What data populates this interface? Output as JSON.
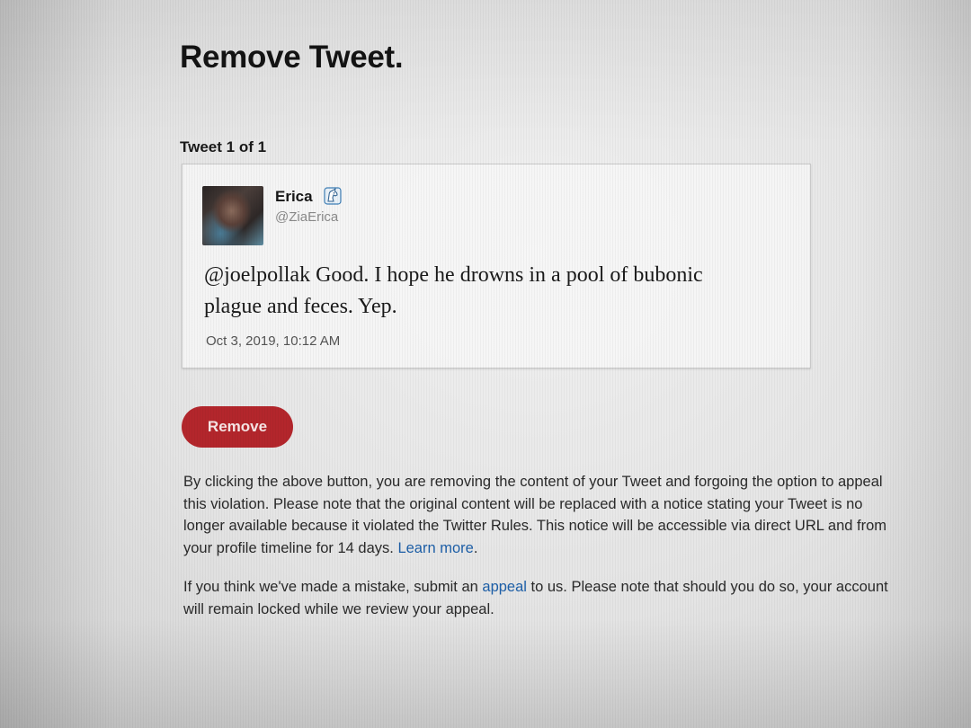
{
  "page": {
    "title": "Remove Tweet."
  },
  "tweet_count": "Tweet 1 of 1",
  "tweet": {
    "name": "Erica",
    "handle": "@ZiaErica",
    "text_line1": "@joelpollak Good. I hope he drowns in a pool of bubonic",
    "text_line2": "plague and feces. Yep.",
    "timestamp": "Oct 3, 2019, 10:12 AM",
    "avatar_icon": "profile-photo",
    "badge_icon": "unicorn-emoji"
  },
  "actions": {
    "remove_label": "Remove"
  },
  "notice": {
    "paragraph1_text": "By clicking the above button, you are removing the content of your Tweet and forgoing the option to appeal this violation. Please note that the original content will be replaced with a notice stating your Tweet is no longer available because it violated the Twitter Rules. This notice will be accessible via direct URL and from your profile timeline for 14 days. ",
    "learn_more_label": "Learn more",
    "paragraph1_end": ".",
    "paragraph2_before": "If you think we've made a mistake, submit an ",
    "appeal_label": "appeal",
    "paragraph2_after": " to us. Please note that should you do so, your account will remain locked while we review your appeal."
  },
  "colors": {
    "remove_button": "#b3262c",
    "link": "#1d5fa8",
    "handle": "#8a8a8a"
  }
}
